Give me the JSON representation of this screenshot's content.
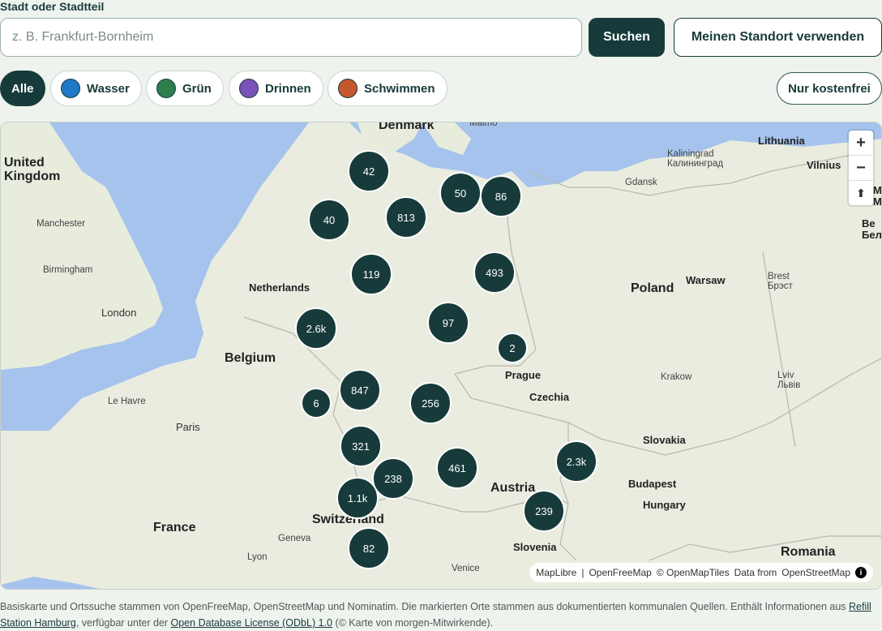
{
  "search": {
    "label": "Stadt oder Stadtteil",
    "placeholder": "z. B. Frankfurt-Bornheim",
    "value": "",
    "search_button": "Suchen",
    "locate_button": "Meinen Standort verwenden"
  },
  "filters": {
    "chips": [
      {
        "label": "Alle",
        "active": true
      },
      {
        "label": "Wasser",
        "color": "#1f78c8"
      },
      {
        "label": "Grün",
        "color": "#2e7d4f"
      },
      {
        "label": "Drinnen",
        "color": "#7b52b8"
      },
      {
        "label": "Schwimmen",
        "color": "#c4582c"
      }
    ],
    "free_only": "Nur kostenfrei"
  },
  "map": {
    "labels": {
      "denmark": "Denmark",
      "malmo": "Malmö",
      "uk": "United\nKingdom",
      "manchester": "Manchester",
      "birmingham": "Birmingham",
      "london": "London",
      "netherlands": "Netherlands",
      "belgium": "Belgium",
      "lehavre": "Le Havre",
      "paris": "Paris",
      "france": "France",
      "lyon": "Lyon",
      "geneva": "Geneva",
      "switzerland": "Switzerland",
      "austria": "Austria",
      "venice": "Venice",
      "slovenia": "Slovenia",
      "czechia": "Czechia",
      "prague": "Prague",
      "poland": "Poland",
      "warsaw": "Warsaw",
      "krakow": "Krakow",
      "lviv": "Lviv\nЛьвів",
      "brest": "Brest\nБрэст",
      "slovakia": "Slovakia",
      "budapest": "Budapest",
      "hungary": "Hungary",
      "romania": "Romania",
      "kaliningrad": "Kaliningrad\nКалининград",
      "gdansk": "Gdansk",
      "lithuania": "Lithuania",
      "vilnius": "Vilnius",
      "be": "Be\nБел",
      "mi": "M\nM"
    },
    "clusters": [
      "42",
      "50",
      "86",
      "40",
      "813",
      "119",
      "493",
      "2.6k",
      "97",
      "2",
      "847",
      "6",
      "256",
      "321",
      "461",
      "2.3k",
      "238",
      "1.1k",
      "239",
      "82"
    ],
    "zoom_in": "+",
    "zoom_out": "−",
    "compass": "⬆",
    "attribution": {
      "maplibre": "MapLibre",
      "sep": "|",
      "ofm": "OpenFreeMap",
      "omt": "© OpenMapTiles",
      "data_from": "Data from",
      "osm": "OpenStreetMap"
    }
  },
  "footer": {
    "text1": "Basiskarte und Ortssuche stammen von OpenFreeMap, OpenStreetMap und Nominatim. Die markierten Orte stammen aus dokumentierten kommunalen Quellen. Enthält Informationen aus ",
    "link1": "Refill Station Hamburg",
    "text2": ", verfügbar unter der ",
    "link2": "Open Database License (ODbL) 1.0",
    "text3": " (© Karte von morgen-Mitwirkende)."
  }
}
